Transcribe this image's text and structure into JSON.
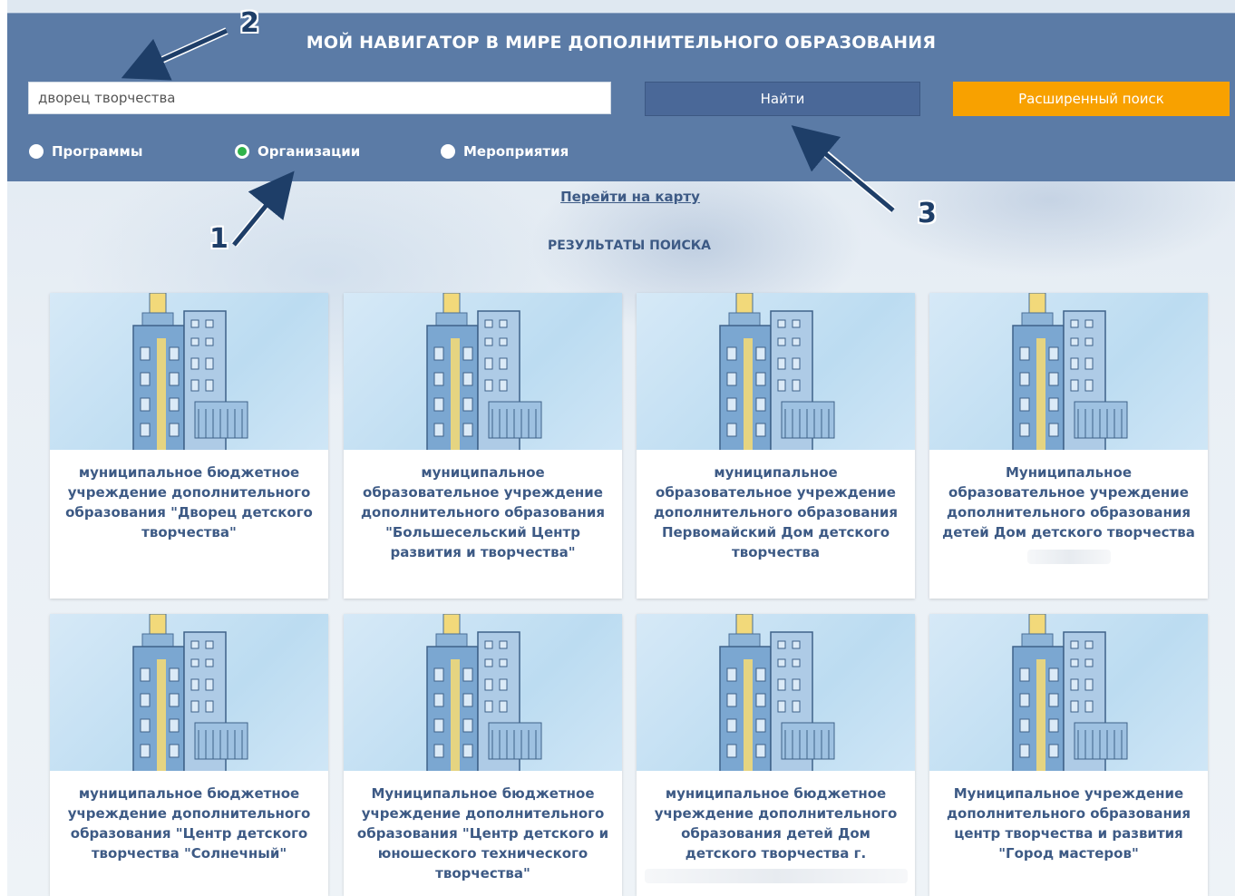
{
  "header": {
    "title": "МОЙ НАВИГАТОР В МИРЕ ДОПОЛНИТЕЛЬНОГО ОБРАЗОВАНИЯ",
    "search_value": "дворец творчества",
    "find_label": "Найти",
    "advanced_label": "Расширенный поиск",
    "filters": [
      {
        "label": "Программы",
        "checked": false
      },
      {
        "label": "Организации",
        "checked": true
      },
      {
        "label": "Мероприятия",
        "checked": false
      }
    ]
  },
  "map_link": "Перейти на карту",
  "results_title": "РЕЗУЛЬТАТЫ ПОИСКА",
  "annotations": [
    "1",
    "2",
    "3"
  ],
  "results": [
    {
      "name": "муниципальное бюджетное учреждение дополнительного образования \"Дворец детского творчества\""
    },
    {
      "name": "муниципальное образовательное учреждение дополнительного образования \"Большесельский Центр развития и творчества\""
    },
    {
      "name": "муниципальное образовательное учреждение дополнительного образования Первомайский Дом детского творчества"
    },
    {
      "name": "Муниципальное образовательное учреждение дополнительного образования детей Дом детского творчества"
    },
    {
      "name": "муниципальное бюджетное учреждение дополнительного образования \"Центр детского творчества \"Солнечный\""
    },
    {
      "name": "Муниципальное бюджетное учреждение дополнительного образования \"Центр детского и юношеского технического творчества\""
    },
    {
      "name": "муниципальное бюджетное учреждение дополнительного образования детей Дом детского творчества г."
    },
    {
      "name": "Муниципальное учреждение дополнительного образования центр творчества и развития \"Город мастеров\""
    }
  ],
  "colors": {
    "header_bg": "#5b7ba6",
    "find_button": "#4a6898",
    "advanced_button": "#f8a100",
    "link_text": "#3d5a85",
    "radio_checked": "#2fb24a"
  },
  "icons": [
    "building-illustration",
    "annotation-arrow"
  ]
}
